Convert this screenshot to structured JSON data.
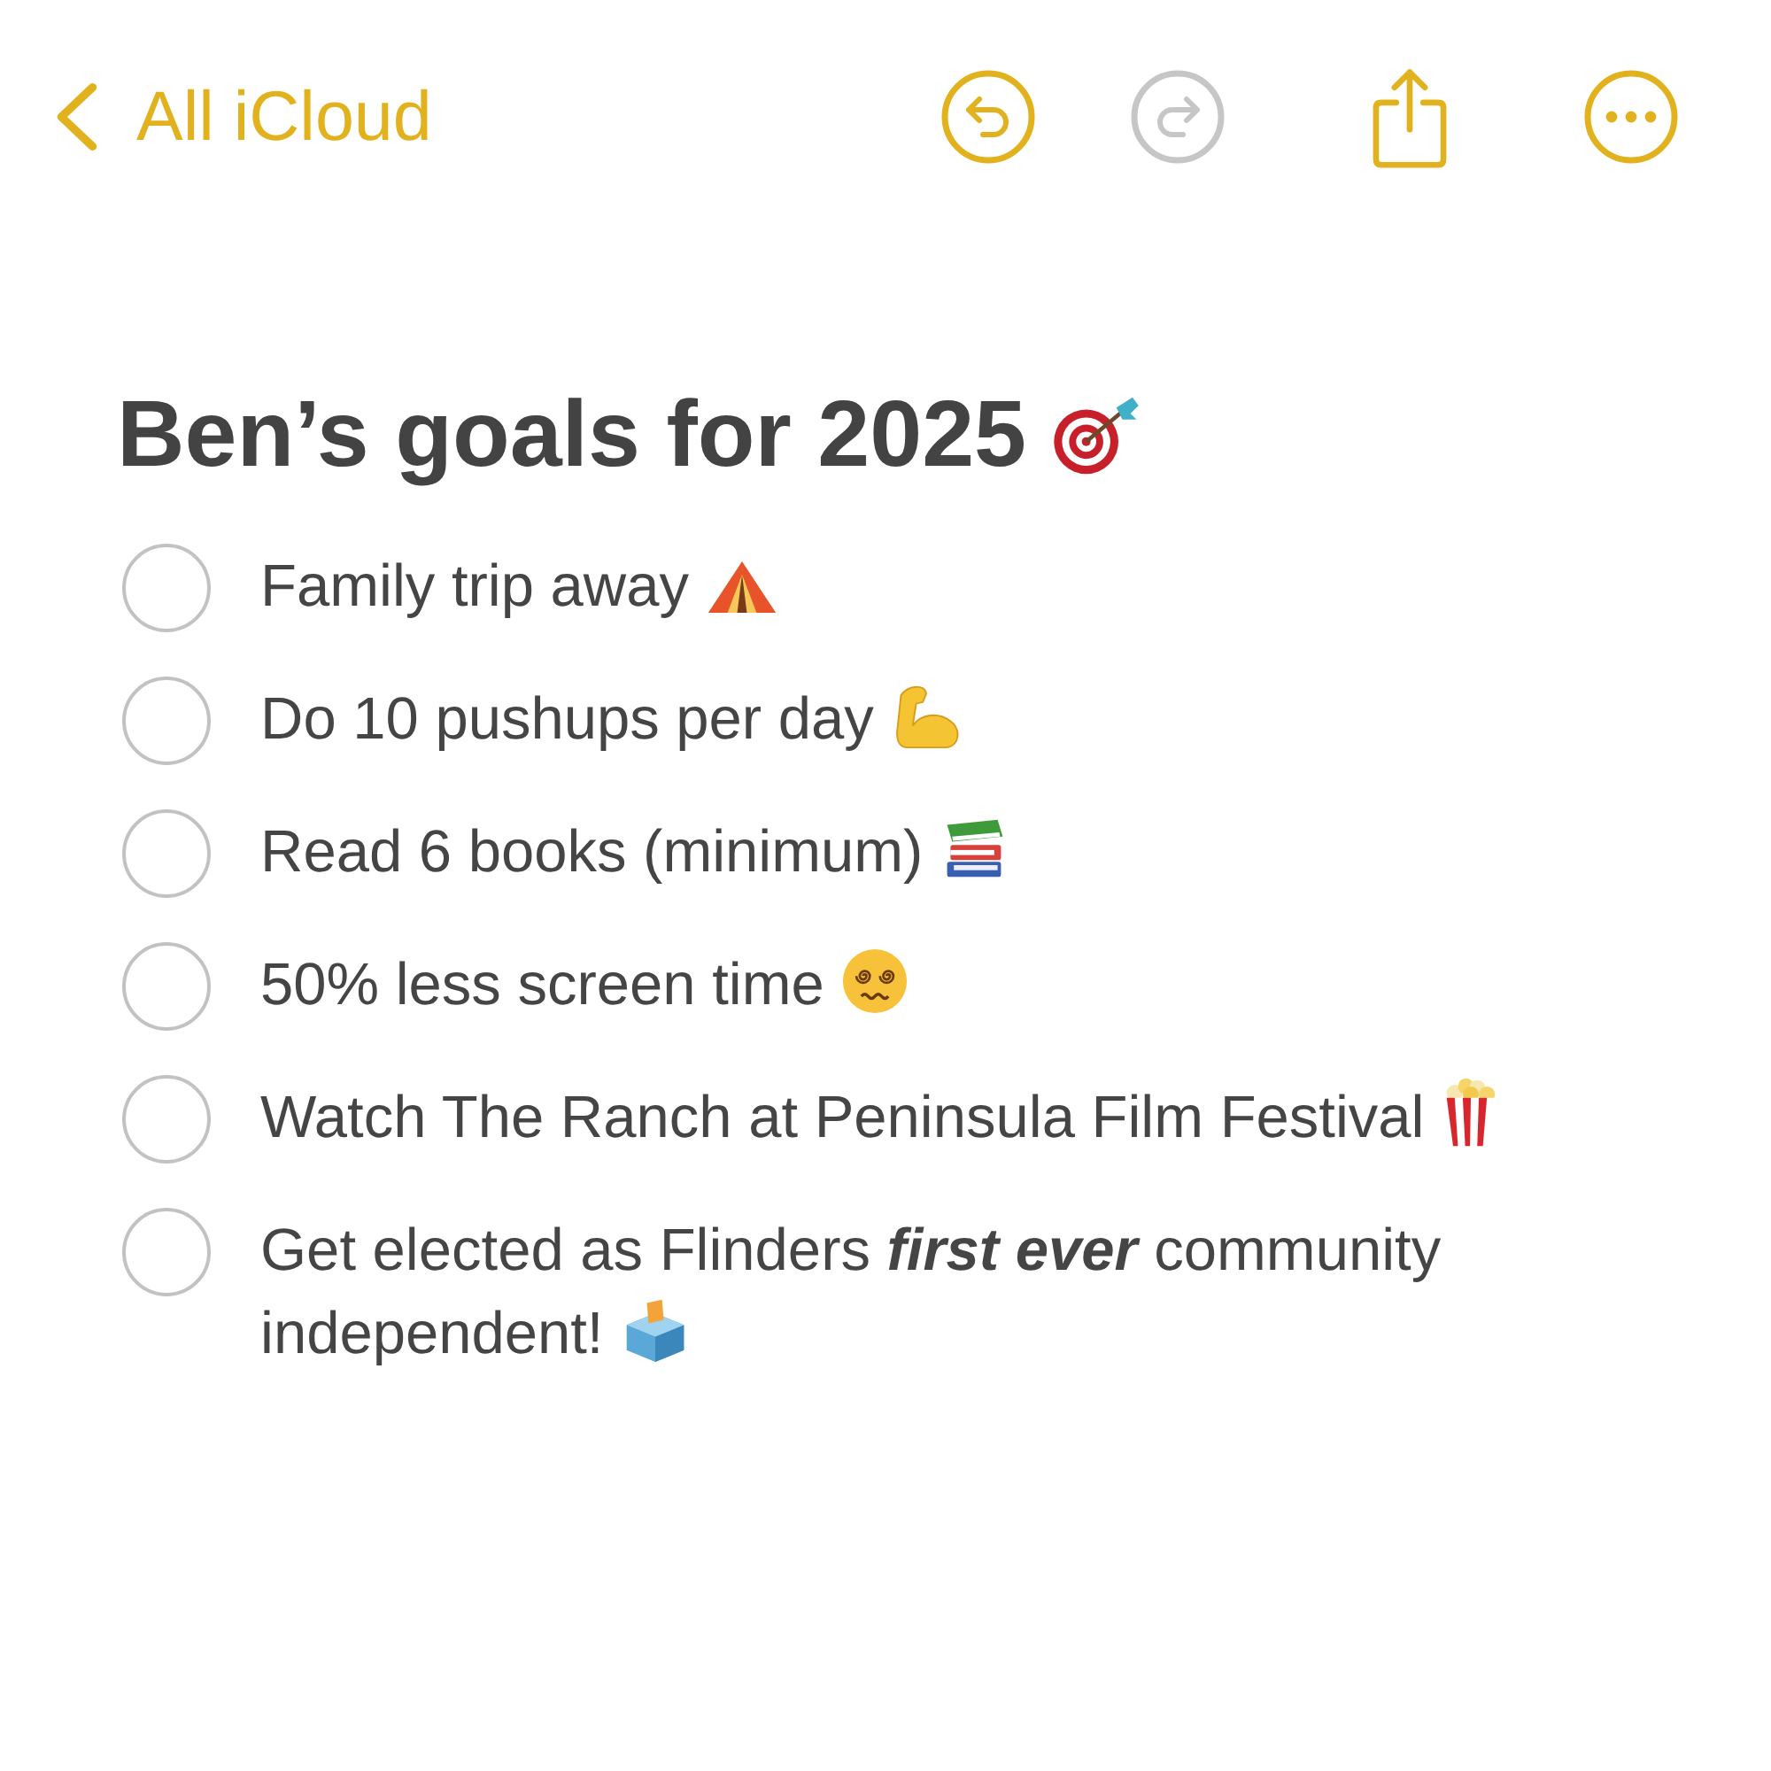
{
  "nav": {
    "back_label": "All iCloud"
  },
  "toolbar": {
    "undo": {
      "disabled": false
    },
    "redo": {
      "disabled": true
    }
  },
  "note": {
    "title": "Ben’s goals for 2025",
    "items": [
      {
        "text": "Family trip away",
        "checked": false
      },
      {
        "text": "Do 10 pushups per day",
        "checked": false
      },
      {
        "text": "Read 6 books (minimum)",
        "checked": false
      },
      {
        "text": "50% less screen time",
        "checked": false
      },
      {
        "text": "Watch The Ranch at Peninsula Film Festival",
        "checked": false
      },
      {
        "text": "Get elected as Flinders **first ever** community independent!",
        "checked": false
      }
    ]
  }
}
